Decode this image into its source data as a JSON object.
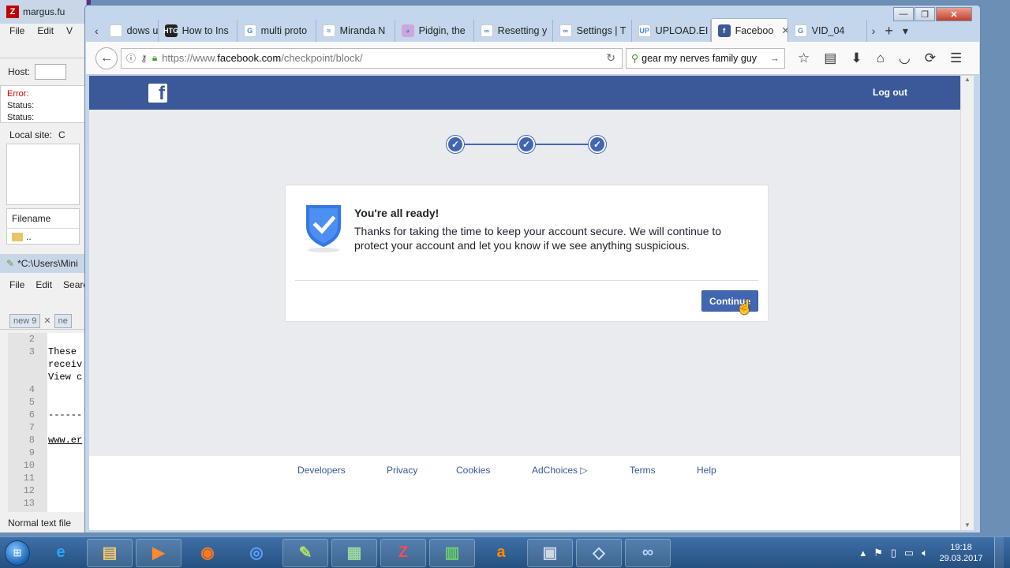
{
  "filezilla": {
    "title": "margus.fu",
    "menu": [
      "File",
      "Edit",
      "V"
    ],
    "host_label": "Host:",
    "log": [
      {
        "label": "Error:",
        "type": "error"
      },
      {
        "label": "Status:",
        "type": "status"
      },
      {
        "label": "Status:",
        "type": "status"
      }
    ],
    "local_site_label": "Local site:",
    "local_site_value": "C",
    "filename_header": "Filename",
    "parent_dir": ".."
  },
  "notepad": {
    "title": "*C:\\Users\\Mini",
    "menu": [
      "File",
      "Edit",
      "Searc"
    ],
    "tabs": [
      "new 9",
      "ne"
    ],
    "lines": [
      {
        "n": "2",
        "t": ""
      },
      {
        "n": "3",
        "t": "These"
      },
      {
        "n": "",
        "t": "receiv"
      },
      {
        "n": "",
        "t": "View c"
      },
      {
        "n": "4",
        "t": ""
      },
      {
        "n": "5",
        "t": ""
      },
      {
        "n": "6",
        "t": "------"
      },
      {
        "n": "7",
        "t": ""
      },
      {
        "n": "8",
        "t": "www.er"
      },
      {
        "n": "9",
        "t": ""
      },
      {
        "n": "10",
        "t": ""
      },
      {
        "n": "11",
        "t": ""
      },
      {
        "n": "12",
        "t": ""
      },
      {
        "n": "13",
        "t": ""
      }
    ],
    "status": "Normal text file"
  },
  "browser": {
    "window_controls": {
      "minimize": "—",
      "maximize": "❐",
      "close": "✕"
    },
    "tab_overflow_left": "‹",
    "tabs": [
      {
        "label": "dows u",
        "icon": "windows-icon",
        "icon_text": "",
        "icon_color": "#ffffff",
        "active": false
      },
      {
        "label": "How to Ins",
        "icon": "htg-icon",
        "icon_text": "HTG",
        "icon_color": "#222222",
        "active": false
      },
      {
        "label": "multi proto",
        "icon": "google-icon",
        "icon_text": "G",
        "icon_color": "#ffffff",
        "active": false
      },
      {
        "label": "Miranda N",
        "icon": "miranda-icon",
        "icon_text": "≈",
        "icon_color": "#ffffff",
        "active": false
      },
      {
        "label": "Pidgin, the",
        "icon": "pidgin-icon",
        "icon_text": "◕",
        "icon_color": "#cfa6d8",
        "active": false
      },
      {
        "label": "Resetting y",
        "icon": "link-icon",
        "icon_text": "∞",
        "icon_color": "#ffffff",
        "active": false
      },
      {
        "label": "Settings | T",
        "icon": "link-icon",
        "icon_text": "∞",
        "icon_color": "#ffffff",
        "active": false
      },
      {
        "label": "UPLOAD.EI",
        "icon": "upload-icon",
        "icon_text": "UP",
        "icon_color": "#ffffff",
        "active": false
      },
      {
        "label": "Faceboo",
        "icon": "facebook-icon",
        "icon_text": "f",
        "icon_color": "#3b5998",
        "active": true
      },
      {
        "label": "VID_04",
        "icon": "google-icon",
        "icon_text": "G",
        "icon_color": "#ffffff",
        "active": false
      }
    ],
    "tab_close": "✕",
    "tab_overflow_right": "›",
    "new_tab": "+",
    "tab_list": "▾",
    "url_prefix": "https://www.",
    "url_host": "facebook.com",
    "url_path": "/checkpoint/block/",
    "search_value": "gear my nerves family guy"
  },
  "page": {
    "logo": "f",
    "logout_label": "Log out",
    "steps": [
      "✓",
      "✓",
      "✓"
    ],
    "card_title": "You're all ready!",
    "card_text": "Thanks for taking the time to keep your account secure. We will continue to protect your account and let you know if we see anything suspicious.",
    "continue_label": "Continue",
    "footer_links": [
      "Developers",
      "Privacy",
      "Cookies",
      "AdChoices",
      "Terms",
      "Help"
    ],
    "colors": {
      "facebook_blue": "#3b5998",
      "button_blue": "#4267b2",
      "page_bg": "#e9ebee"
    }
  },
  "taskbar": {
    "apps": [
      {
        "name": "internet-explorer-icon",
        "glyph": "e",
        "color": "#2aa7ff",
        "pinned": false
      },
      {
        "name": "file-explorer-icon",
        "glyph": "▤",
        "color": "#f1c96a",
        "pinned": true
      },
      {
        "name": "media-player-icon",
        "glyph": "▶",
        "color": "#ff8a2a",
        "pinned": true
      },
      {
        "name": "firefox-icon",
        "glyph": "◉",
        "color": "#ff7a1a",
        "pinned": false
      },
      {
        "name": "thunderbird-icon",
        "glyph": "◎",
        "color": "#5aa0ff",
        "pinned": false
      },
      {
        "name": "notepad-plus-icon",
        "glyph": "✎",
        "color": "#a8e06a",
        "pinned": true
      },
      {
        "name": "system-monitor-icon",
        "glyph": "▦",
        "color": "#9fd59f",
        "pinned": true
      },
      {
        "name": "filezilla-icon",
        "glyph": "Z",
        "color": "#ff4b4b",
        "pinned": true
      },
      {
        "name": "spreadsheet-icon",
        "glyph": "▥",
        "color": "#6ad06a",
        "pinned": true
      },
      {
        "name": "avast-icon",
        "glyph": "a",
        "color": "#ff8a00",
        "pinned": false
      },
      {
        "name": "archive-icon",
        "glyph": "▣",
        "color": "#cfd8e6",
        "pinned": true
      },
      {
        "name": "eraser-icon",
        "glyph": "◇",
        "color": "#cfe6ff",
        "pinned": true
      },
      {
        "name": "link-app-icon",
        "glyph": "∞",
        "color": "#b8d8ff",
        "pinned": true
      }
    ],
    "time": "19:18",
    "date": "29.03.2017"
  }
}
